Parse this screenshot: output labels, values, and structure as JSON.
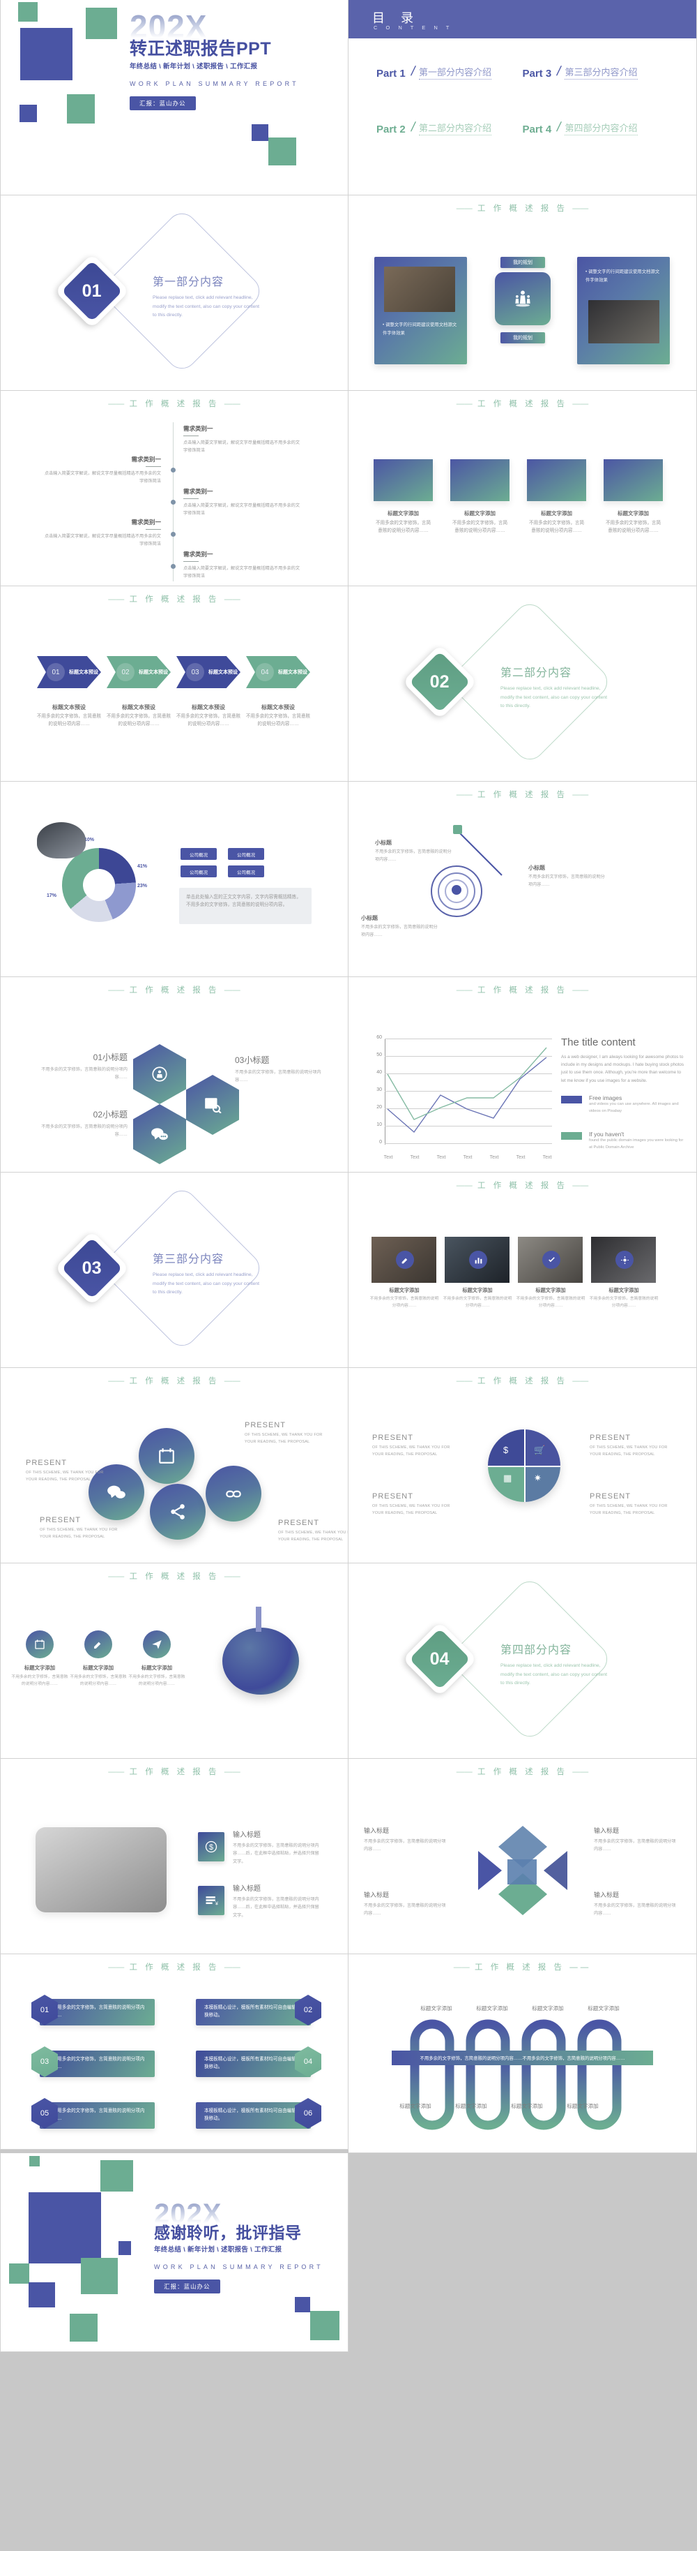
{
  "brand": {
    "blue": "#4a55a5",
    "green": "#6cad92",
    "light_blue": "#8f97c9",
    "light_green": "#a5cdb8"
  },
  "cover": {
    "ghost_year": "202X",
    "title": "转正述职报告PPT",
    "subtitle": "年终总结 \\ 新年计划 \\ 述职报告 \\ 工作汇报",
    "english": "WORK PLAN SUMMARY REPORT",
    "reporter_badge": "汇报：蓝山办公"
  },
  "toc": {
    "cn": "目 录",
    "en": "C O N T E N T",
    "items": [
      {
        "part": "Part 1",
        "label": "第一部分内容介绍"
      },
      {
        "part": "Part 3",
        "label": "第三部分内容介绍"
      },
      {
        "part": "Part 2",
        "label": "第二部分内容介绍"
      },
      {
        "part": "Part 4",
        "label": "第四部分内容介绍"
      }
    ]
  },
  "section_header": {
    "dash_left": "——",
    "text": "工 作 概 述 报 告",
    "dash_right": "——"
  },
  "dividers": [
    {
      "num": "01",
      "title": "第一部分内容",
      "body": "Please replace text, click add relevant headline, modify the text content, also can copy your content to this directly."
    },
    {
      "num": "02",
      "title": "第二部分内容",
      "body": "Please replace text, click add relevant headline, modify the text content, also can copy your content to this directly."
    },
    {
      "num": "03",
      "title": "第三部分内容",
      "body": "Please replace text, click add relevant headline, modify the text content, also can copy your content to this directly."
    },
    {
      "num": "04",
      "title": "第四部分内容",
      "body": "Please replace text, click add relevant headline, modify the text content, also can copy your content to this directly."
    }
  ],
  "slide_cards": {
    "pill_top": "我的规划",
    "pill_bottom": "我的规划",
    "bullet": "调整文字的行间距建议使用文档源文件字体效果"
  },
  "chevrons": {
    "steps": [
      {
        "num": "01",
        "label": "标题文本预设"
      },
      {
        "num": "02",
        "label": "标题文本预设"
      },
      {
        "num": "03",
        "label": "标题文本预设"
      },
      {
        "num": "04",
        "label": "标题文本预设"
      }
    ],
    "captions": [
      {
        "title": "标题文本预设",
        "body": "不用多余的文字修饰，言简意赅的说明分项内容……"
      },
      {
        "title": "标题文本预设",
        "body": "不用多余的文字修饰，言简意赅的说明分项内容……"
      },
      {
        "title": "标题文本预设",
        "body": "不用多余的文字修饰，言简意赅的说明分项内容……"
      },
      {
        "title": "标题文本预设",
        "body": "不用多余的文字修饰，言简意赅的说明分项内容……"
      }
    ]
  },
  "timeline": {
    "items": [
      {
        "title": "需求类别一",
        "body": "点击输入简要文字解说，解说文字尽量概括精选不用多余的文字修饰简洁"
      },
      {
        "title": "需求类别一",
        "body": "点击输入简要文字解说，解说文字尽量概括精选不用多余的文字修饰简洁"
      },
      {
        "title": "需求类别一",
        "body": "点击输入简要文字解说，解说文字尽量概括精选不用多余的文字修饰简洁"
      },
      {
        "title": "需求类别一",
        "body": "点击输入简要文字解说，解说文字尽量概括精选不用多余的文字修饰简洁"
      },
      {
        "title": "需求类别一",
        "body": "点击输入简要文字解说，解说文字尽量概括精选不用多余的文字修饰简洁"
      },
      {
        "title": "需求类别一",
        "body": "点击输入简要文字解说，解说文字尽量概括精选不用多余的文字修饰简洁"
      },
      {
        "title": "需求类别一",
        "body": "点击输入简要文字解说，解说文字尽量概括精选不用多余的文字修饰简洁"
      }
    ]
  },
  "gradient_squares": {
    "items": [
      {
        "title": "标题文字添加",
        "body": "不用多余的文字修饰，言简意赅的说明分项内容……"
      },
      {
        "title": "标题文字添加",
        "body": "不用多余的文字修饰，言简意赅的说明分项内容……"
      },
      {
        "title": "标题文字添加",
        "body": "不用多余的文字修饰，言简意赅的说明分项内容……"
      },
      {
        "title": "标题文字添加",
        "body": "不用多余的文字修饰，言简意赅的说明分项内容……"
      }
    ]
  },
  "pie_slide": {
    "labels": [
      "41%",
      "23%",
      "17%",
      "10%"
    ],
    "tags": [
      "公司概况",
      "公司概况",
      "公司概况",
      "公司概况"
    ],
    "note": "单击此处输入您的正文文字内容，文字内容需概括精炼，不用多余的文字修饰，言简意赅的说明分项内容。"
  },
  "target_slide": {
    "notes": [
      {
        "title": "小标题",
        "body": "不用多余的文字修饰，言简意赅的说明分项内容……"
      },
      {
        "title": "小标题",
        "body": "不用多余的文字修饰，言简意赅的说明分项内容……"
      },
      {
        "title": "小标题",
        "body": "不用多余的文字修饰，言简意赅的说明分项内容……"
      }
    ]
  },
  "hexagons": {
    "items": [
      {
        "title": "01小标题",
        "body": "不用多余的文字修饰，言简意赅的说明分项内容……"
      },
      {
        "title": "02小标题",
        "body": "不用多余的文字修饰，言简意赅的说明分项内容……"
      },
      {
        "title": "03小标题",
        "body": "不用多余的文字修饰，言简意赅的说明分项内容……"
      }
    ]
  },
  "chart_slide": {
    "title": "The title content",
    "body": "As a web designer, I am always looking for awesome photos to include in my designs and mockups. I hate buying stock photos just to use them once. Although, you're more than welcome to let me know if you use images for a website.",
    "legend": [
      {
        "name": "Free images",
        "desc": "and videos you can use anywhere. All images and videos on Pixabay"
      },
      {
        "name": "If you haven't",
        "desc": "found the public domain images you were looking for at Public Domain Archive"
      }
    ]
  },
  "chart_data": {
    "type": "line",
    "title": "The title content",
    "xlabel": "",
    "ylabel": "",
    "ylim": [
      0,
      60
    ],
    "yticks": [
      0,
      10,
      20,
      30,
      40,
      50,
      60
    ],
    "grid": true,
    "legend_position": "right",
    "categories": [
      "Text",
      "Text",
      "Text",
      "Text",
      "Text",
      "Text",
      "Text"
    ],
    "series": [
      {
        "name": "Free images",
        "color": "#4a55a5",
        "values": [
          20,
          6.5,
          28,
          20,
          15,
          37,
          48.5
        ]
      },
      {
        "name": "If you haven't",
        "color": "#6cad92",
        "values": [
          40,
          13.5,
          21,
          26,
          26,
          38,
          55
        ]
      }
    ]
  },
  "photo_row": {
    "items": [
      {
        "title": "标题文字添加",
        "body": "不用多余的文字修饰，言简意赅的说明分项内容……"
      },
      {
        "title": "标题文字添加",
        "body": "不用多余的文字修饰，言简意赅的说明分项内容……"
      },
      {
        "title": "标题文字添加",
        "body": "不用多余的文字修饰，言简意赅的说明分项内容……"
      },
      {
        "title": "标题文字添加",
        "body": "不用多余的文字修饰，言简意赅的说明分项内容……"
      }
    ]
  },
  "present": {
    "label": "PRESENT",
    "body": "OF THIS SCHEME, WE THANK YOU FOR YOUR READING, THE PROPOSAL",
    "items": [
      {
        "label": "PRESENT",
        "body": "OF THIS SCHEME, WE THANK YOU FOR YOUR READING, THE PROPOSAL"
      },
      {
        "label": "PRESENT",
        "body": "OF THIS SCHEME, WE THANK YOU FOR YOUR READING, THE PROPOSAL"
      },
      {
        "label": "PRESENT",
        "body": "OF THIS SCHEME, WE THANK YOU FOR YOUR READING, THE PROPOSAL"
      },
      {
        "label": "PRESENT",
        "body": "OF THIS SCHEME, WE THANK YOU FOR YOUR READING, THE PROPOSAL"
      }
    ]
  },
  "icon_row": {
    "items": [
      {
        "title": "标题文字添加",
        "body": "不用多余的文字修饰，言简意赅的说明分项内容……"
      },
      {
        "title": "标题文字添加",
        "body": "不用多余的文字修饰，言简意赅的说明分项内容……"
      },
      {
        "title": "标题文字添加",
        "body": "不用多余的文字修饰，言简意赅的说明分项内容……"
      },
      {
        "title": "标题文字添加",
        "body": "不用多余的文字修饰，言简意赅的说明分项内容……"
      }
    ]
  },
  "input_title_slide": {
    "items": [
      {
        "title": "输入标题",
        "body": "不用多余的文字修饰，言简意赅的说明分项内容……后，在此框中选择粘贴，并选择只保留文字。"
      },
      {
        "title": "输入标题",
        "body": "不用多余的文字修饰，言简意赅的说明分项内容……后，在此框中选择粘贴，并选择只保留文字。"
      }
    ]
  },
  "arrows_slide": {
    "items": [
      {
        "title": "输入标题",
        "body": "不用多余的文字修饰，言简意赅的说明分项内容……"
      },
      {
        "title": "输入标题",
        "body": "不用多余的文字修饰，言简意赅的说明分项内容……"
      },
      {
        "title": "输入标题",
        "body": "不用多余的文字修饰，言简意赅的说明分项内容……"
      },
      {
        "title": "输入标题",
        "body": "不用多余的文字修饰，言简意赅的说明分项内容……"
      }
    ]
  },
  "hex_bars": {
    "items": [
      {
        "num": "01",
        "body": "本不用多余的文字修饰，言简意赅的说明分项内容……",
        "hex": "blue"
      },
      {
        "num": "02",
        "body": "本模板精心设计，模板所有素材均可自由编辑替换移动。",
        "hex": "blue"
      },
      {
        "num": "03",
        "body": "本不用多余的文字修饰，言简意赅的说明分项内容……",
        "hex": "green"
      },
      {
        "num": "04",
        "body": "本模板精心设计，模板所有素材均可自由编辑替换移动。",
        "hex": "green"
      },
      {
        "num": "05",
        "body": "本不用多余的文字修饰，言简意赅的说明分项内容……",
        "hex": "blue"
      },
      {
        "num": "06",
        "body": "本模板精心设计，模板所有素材均可自由编辑替换移动。",
        "hex": "blue"
      }
    ]
  },
  "loops_slide": {
    "top_labels": [
      "标题文字添加",
      "标题文字添加",
      "标题文字添加",
      "标题文字添加"
    ],
    "bottom_labels": [
      "标题文字添加",
      "标题文字添加",
      "标题文字添加",
      "标题文字添加"
    ],
    "band": "不用多余的文字修饰，言简意赅的说明分项内容……不用多余的文字修饰，言简意赅的说明分项内容……"
  },
  "thanks": {
    "ghost_year": "202X",
    "title": "感谢聆听，批评指导",
    "subtitle": "年终总结 \\ 新年计划 \\ 述职报告 \\ 工作汇报",
    "english": "WORK PLAN SUMMARY REPORT",
    "reporter_badge": "汇报：蓝山办公"
  }
}
